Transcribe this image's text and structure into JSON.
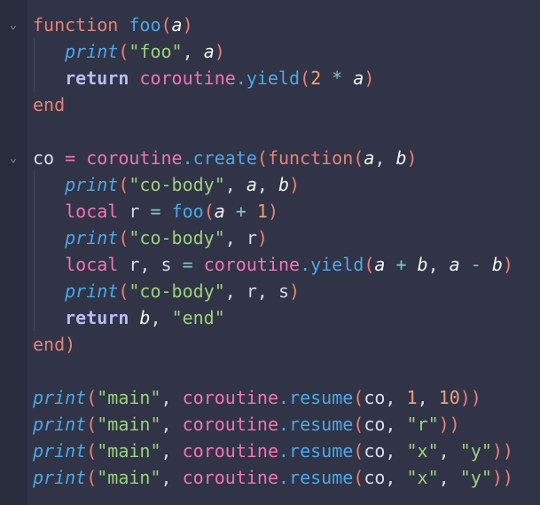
{
  "editor": {
    "language": "lua",
    "folded_lines": [
      0,
      5
    ],
    "lines": [
      [
        [
          "function ",
          "kw"
        ],
        [
          "foo",
          "fn"
        ],
        [
          "(",
          "punc"
        ],
        [
          "a",
          "param"
        ],
        [
          ")",
          "punc"
        ]
      ],
      [
        [
          "   ",
          ""
        ],
        [
          "print",
          "call"
        ],
        [
          "(",
          "punc"
        ],
        [
          "\"foo\"",
          "str"
        ],
        [
          ", ",
          "txt"
        ],
        [
          "a",
          "param"
        ],
        [
          ")",
          "punc"
        ]
      ],
      [
        [
          "   ",
          ""
        ],
        [
          "return ",
          "ret"
        ],
        [
          "coroutine",
          "mod"
        ],
        [
          ".yield",
          "fn"
        ],
        [
          "(",
          "punc"
        ],
        [
          "2",
          "num"
        ],
        [
          " * ",
          "op2"
        ],
        [
          "a",
          "param"
        ],
        [
          ")",
          "punc"
        ]
      ],
      [
        [
          "end",
          "kw"
        ]
      ],
      [],
      [
        [
          "co ",
          "txt"
        ],
        [
          "= ",
          "op"
        ],
        [
          "coroutine",
          "mod"
        ],
        [
          ".create",
          "fn"
        ],
        [
          "(",
          "punc"
        ],
        [
          "function",
          "kw"
        ],
        [
          "(",
          "punc"
        ],
        [
          "a",
          "param"
        ],
        [
          ", ",
          "txt"
        ],
        [
          "b",
          "param"
        ],
        [
          ")",
          "punc"
        ]
      ],
      [
        [
          "   ",
          ""
        ],
        [
          "print",
          "call"
        ],
        [
          "(",
          "punc"
        ],
        [
          "\"co-body\"",
          "str"
        ],
        [
          ", ",
          "txt"
        ],
        [
          "a",
          "param"
        ],
        [
          ", ",
          "txt"
        ],
        [
          "b",
          "param"
        ],
        [
          ")",
          "punc"
        ]
      ],
      [
        [
          "   ",
          ""
        ],
        [
          "local ",
          "loc"
        ],
        [
          "r ",
          "txt"
        ],
        [
          "= ",
          "op2"
        ],
        [
          "foo",
          "fn"
        ],
        [
          "(",
          "punc"
        ],
        [
          "a",
          "param"
        ],
        [
          " + ",
          "op2"
        ],
        [
          "1",
          "num"
        ],
        [
          ")",
          "punc"
        ]
      ],
      [
        [
          "   ",
          ""
        ],
        [
          "print",
          "call"
        ],
        [
          "(",
          "punc"
        ],
        [
          "\"co-body\"",
          "str"
        ],
        [
          ", ",
          "txt"
        ],
        [
          "r",
          "txt"
        ],
        [
          ")",
          "punc"
        ]
      ],
      [
        [
          "   ",
          ""
        ],
        [
          "local ",
          "loc"
        ],
        [
          "r, s ",
          "txt"
        ],
        [
          "= ",
          "op2"
        ],
        [
          "coroutine",
          "mod"
        ],
        [
          ".yield",
          "fn"
        ],
        [
          "(",
          "punc"
        ],
        [
          "a",
          "param"
        ],
        [
          " + ",
          "op2"
        ],
        [
          "b",
          "param"
        ],
        [
          ", ",
          "txt"
        ],
        [
          "a",
          "param"
        ],
        [
          " - ",
          "op2"
        ],
        [
          "b",
          "param"
        ],
        [
          ")",
          "punc"
        ]
      ],
      [
        [
          "   ",
          ""
        ],
        [
          "print",
          "call"
        ],
        [
          "(",
          "punc"
        ],
        [
          "\"co-body\"",
          "str"
        ],
        [
          ", ",
          "txt"
        ],
        [
          "r",
          "txt"
        ],
        [
          ", ",
          "txt"
        ],
        [
          "s",
          "txt"
        ],
        [
          ")",
          "punc"
        ]
      ],
      [
        [
          "   ",
          ""
        ],
        [
          "return ",
          "ret"
        ],
        [
          "b",
          "param"
        ],
        [
          ", ",
          "txt"
        ],
        [
          "\"end\"",
          "str"
        ]
      ],
      [
        [
          "end",
          "kw"
        ],
        [
          ")",
          "punc"
        ]
      ],
      [],
      [
        [
          "print",
          "call"
        ],
        [
          "(",
          "punc"
        ],
        [
          "\"main\"",
          "str"
        ],
        [
          ", ",
          "txt"
        ],
        [
          "coroutine",
          "mod"
        ],
        [
          ".resume",
          "fn"
        ],
        [
          "(",
          "punc"
        ],
        [
          "co",
          "txt"
        ],
        [
          ", ",
          "txt"
        ],
        [
          "1",
          "num"
        ],
        [
          ", ",
          "txt"
        ],
        [
          "10",
          "num"
        ],
        [
          "))",
          "punc"
        ]
      ],
      [
        [
          "print",
          "call"
        ],
        [
          "(",
          "punc"
        ],
        [
          "\"main\"",
          "str"
        ],
        [
          ", ",
          "txt"
        ],
        [
          "coroutine",
          "mod"
        ],
        [
          ".resume",
          "fn"
        ],
        [
          "(",
          "punc"
        ],
        [
          "co",
          "txt"
        ],
        [
          ", ",
          "txt"
        ],
        [
          "\"r\"",
          "str"
        ],
        [
          "))",
          "punc"
        ]
      ],
      [
        [
          "print",
          "call"
        ],
        [
          "(",
          "punc"
        ],
        [
          "\"main\"",
          "str"
        ],
        [
          ", ",
          "txt"
        ],
        [
          "coroutine",
          "mod"
        ],
        [
          ".resume",
          "fn"
        ],
        [
          "(",
          "punc"
        ],
        [
          "co",
          "txt"
        ],
        [
          ", ",
          "txt"
        ],
        [
          "\"x\"",
          "str"
        ],
        [
          ", ",
          "txt"
        ],
        [
          "\"y\"",
          "str"
        ],
        [
          "))",
          "punc"
        ]
      ],
      [
        [
          "print",
          "call"
        ],
        [
          "(",
          "punc"
        ],
        [
          "\"main\"",
          "str"
        ],
        [
          ", ",
          "txt"
        ],
        [
          "coroutine",
          "mod"
        ],
        [
          ".resume",
          "fn"
        ],
        [
          "(",
          "punc"
        ],
        [
          "co",
          "txt"
        ],
        [
          ", ",
          "txt"
        ],
        [
          "\"x\"",
          "str"
        ],
        [
          ", ",
          "txt"
        ],
        [
          "\"y\"",
          "str"
        ],
        [
          "))",
          "punc"
        ]
      ]
    ],
    "indent_guide_lines": [
      1,
      2,
      6,
      7,
      8,
      9,
      10,
      11
    ]
  }
}
